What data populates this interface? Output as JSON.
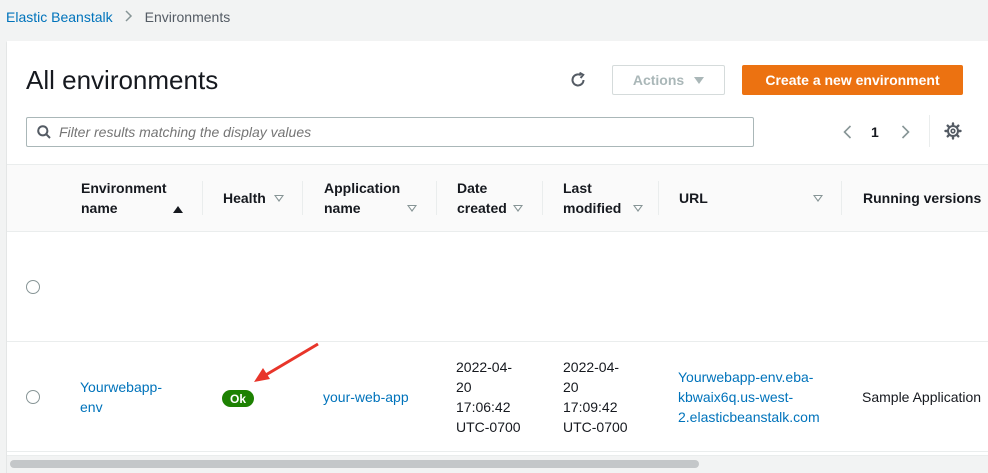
{
  "breadcrumb": {
    "root": "Elastic Beanstalk",
    "current": "Environments"
  },
  "page": {
    "title": "All environments"
  },
  "toolbar": {
    "refresh_icon": "refresh-icon",
    "actions_label": "Actions",
    "create_label": "Create a new environment",
    "accent_color": "#ec7211"
  },
  "search": {
    "placeholder": "Filter results matching the display values",
    "value": ""
  },
  "pagination": {
    "current_page": "1"
  },
  "table": {
    "columns": [
      {
        "line1": "Environment",
        "line2": "name",
        "sort": "ascending"
      },
      {
        "line1": "Health",
        "line2": "",
        "sort": "none"
      },
      {
        "line1": "Application",
        "line2": "name",
        "sort": "none"
      },
      {
        "line1": "Date",
        "line2": "created",
        "sort": "none"
      },
      {
        "line1": "Last",
        "line2": "modified",
        "sort": "none"
      },
      {
        "line1": "URL",
        "line2": "",
        "sort": "none"
      },
      {
        "line1": "Running versions",
        "line2": "",
        "sort": "none"
      }
    ],
    "rows": [
      {
        "env_name_l1": "",
        "env_name_l2": "",
        "health": "",
        "app_name": "",
        "created": [],
        "modified": [],
        "url": [],
        "version": ""
      },
      {
        "env_name_l1": "Yourwebapp-",
        "env_name_l2": "env",
        "health": "Ok",
        "health_color": "#1d8102",
        "app_name": "your-web-app",
        "created": [
          "2022-04-",
          "20",
          "17:06:42",
          "UTC-0700"
        ],
        "modified": [
          "2022-04-",
          "20",
          "17:09:42",
          "UTC-0700"
        ],
        "url": [
          "Yourwebapp-env.eba-",
          "kbwaix6q.us-west-",
          "2.elasticbeanstalk.com"
        ],
        "version": "Sample Application"
      }
    ]
  },
  "annotation": {
    "arrow_color": "#e8352a"
  }
}
